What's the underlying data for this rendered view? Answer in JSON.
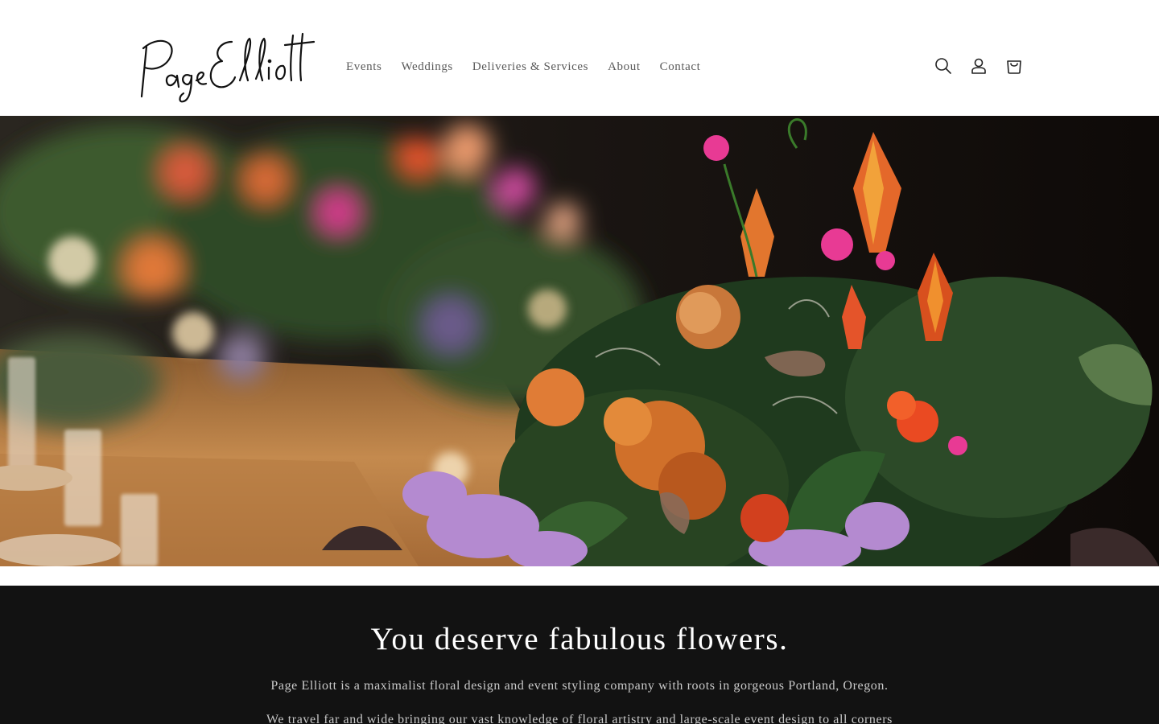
{
  "brand": {
    "logo_text": "Page Elliott",
    "logo_icon": "script-signature-logo"
  },
  "nav": {
    "items": [
      {
        "label": "Events"
      },
      {
        "label": "Weddings"
      },
      {
        "label": "Deliveries & Services"
      },
      {
        "label": "About"
      },
      {
        "label": "Contact"
      }
    ]
  },
  "header_icons": {
    "search": "search-icon",
    "account": "account-icon",
    "cart": "cart-icon"
  },
  "hero": {
    "image": "floral-centerpiece-table-photo"
  },
  "intro": {
    "heading": "You deserve fabulous flowers.",
    "paragraph_1": "Page Elliott is a maximalist floral design and event styling company with roots in gorgeous Portland, Oregon.",
    "paragraph_2": "We travel far and wide bringing our vast knowledge of floral artistry and large-scale event design to all corners"
  },
  "colors": {
    "intro_background": "#121212",
    "nav_text": "#5a5a5a",
    "heading_text": "#ffffff",
    "body_text": "#c9c9c9"
  }
}
